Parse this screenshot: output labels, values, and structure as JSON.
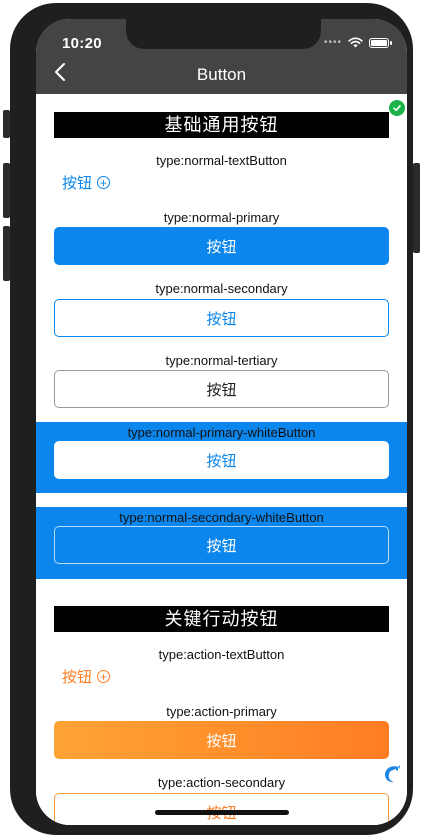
{
  "status_bar": {
    "time": "10:20",
    "signal_icon": "signal-dots-icon",
    "wifi_icon": "wifi-icon",
    "battery_icon": "battery-icon"
  },
  "nav": {
    "title": "Button",
    "back_icon": "chevron-left-icon"
  },
  "sections": {
    "normal": {
      "title": "基础通用按钮",
      "text_button": {
        "type_label": "type:normal-textButton",
        "label": "按钮",
        "icon": "plus-circle-icon",
        "color": "#0a86ec"
      },
      "primary": {
        "type_label": "type:normal-primary",
        "label": "按钮"
      },
      "secondary": {
        "type_label": "type:normal-secondary",
        "label": "按钮"
      },
      "tertiary": {
        "type_label": "type:normal-tertiary",
        "label": "按钮"
      },
      "primary_white": {
        "type_label": "type:normal-primary-whiteButton",
        "label": "按钮"
      },
      "secondary_white": {
        "type_label": "type:normal-secondary-whiteButton",
        "label": "按钮"
      }
    },
    "action": {
      "title": "关键行动按钮",
      "text_button": {
        "type_label": "type:action-textButton",
        "label": "按钮",
        "icon": "plus-circle-icon",
        "color": "#ff7d22"
      },
      "primary": {
        "type_label": "type:action-primary",
        "label": "按钮"
      },
      "secondary": {
        "type_label": "type:action-secondary",
        "label": "按钮"
      }
    }
  },
  "colors": {
    "header_bg": "#444444",
    "primary_blue": "#0a86ec",
    "action_orange_start": "#ffa336",
    "action_orange_end": "#ff7d22",
    "check_badge": "#19b349"
  },
  "overlays": {
    "check_badge_icon": "check-circle-icon",
    "floating_logo_icon": "dolphin-logo-icon"
  }
}
